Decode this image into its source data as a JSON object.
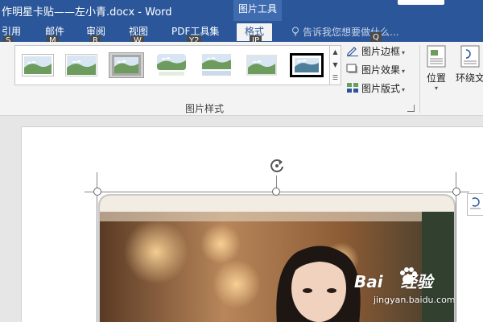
{
  "window": {
    "title": "作明星卡贴——左小青.docx - Word",
    "context_tab_group": "图片工具"
  },
  "tabs": [
    {
      "label": "引用",
      "key": "S"
    },
    {
      "label": "邮件",
      "key": "M"
    },
    {
      "label": "审阅",
      "key": "R"
    },
    {
      "label": "视图",
      "key": "W"
    },
    {
      "label": "PDF工具集",
      "key": "Y2"
    },
    {
      "label": "格式",
      "key": "JP",
      "active": true
    }
  ],
  "tell_me": {
    "placeholder": "告诉我您想要做什么...",
    "key": "Q"
  },
  "picture_styles": {
    "group_label": "图片样式",
    "styles": [
      "simple-frame",
      "soft-edge-frame",
      "gray-frame",
      "rounded-reflection",
      "reflected-bevel",
      "soft-edge-rectangle",
      "black-thick-frame"
    ],
    "selected_index": 2
  },
  "commands": {
    "border": "图片边框",
    "effects": "图片效果",
    "layout": "图片版式"
  },
  "arrange": {
    "position": "位置",
    "wrap_text": "环绕文"
  },
  "watermark": {
    "logo": "Bai",
    "logo_cn": "经验",
    "url": "jingyan.baidu.com"
  },
  "colors": {
    "word_blue": "#2b579a",
    "ribbon_bg": "#f3f3f3",
    "canvas_bg": "#e6e6e6"
  }
}
